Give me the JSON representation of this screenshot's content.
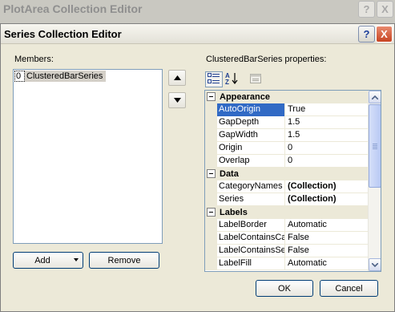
{
  "background_window": {
    "title": "PlotArea Collection Editor",
    "help_label": "?",
    "close_label": "X"
  },
  "dialog": {
    "title": "Series Collection Editor",
    "help_label": "?",
    "close_label": "X"
  },
  "members": {
    "label": "Members:",
    "items": [
      {
        "index": "0",
        "name": "ClusteredBarSeries"
      }
    ]
  },
  "buttons": {
    "add": "Add",
    "remove": "Remove",
    "ok": "OK",
    "cancel": "Cancel"
  },
  "properties": {
    "label": "ClusteredBarSeries properties:",
    "categories": [
      {
        "name": "Appearance",
        "rows": [
          {
            "name": "AutoOrigin",
            "value": "True",
            "selected": true,
            "bold": false
          },
          {
            "name": "GapDepth",
            "value": "1.5",
            "selected": false,
            "bold": false
          },
          {
            "name": "GapWidth",
            "value": "1.5",
            "selected": false,
            "bold": false
          },
          {
            "name": "Origin",
            "value": "0",
            "selected": false,
            "bold": false
          },
          {
            "name": "Overlap",
            "value": "0",
            "selected": false,
            "bold": false
          }
        ]
      },
      {
        "name": "Data",
        "rows": [
          {
            "name": "CategoryNames",
            "value": "(Collection)",
            "selected": false,
            "bold": true
          },
          {
            "name": "Series",
            "value": "(Collection)",
            "selected": false,
            "bold": true
          }
        ]
      },
      {
        "name": "Labels",
        "rows": [
          {
            "name": "LabelBorder",
            "value": "Automatic",
            "selected": false,
            "bold": false
          },
          {
            "name": "LabelContainsCat",
            "value": "False",
            "selected": false,
            "bold": false
          },
          {
            "name": "LabelContainsSer",
            "value": "False",
            "selected": false,
            "bold": false
          },
          {
            "name": "LabelFill",
            "value": "Automatic",
            "selected": false,
            "bold": false
          }
        ]
      }
    ]
  },
  "colors": {
    "dialog_bg": "#ece9d8",
    "selection": "#316ac5",
    "border": "#7f9db9"
  }
}
